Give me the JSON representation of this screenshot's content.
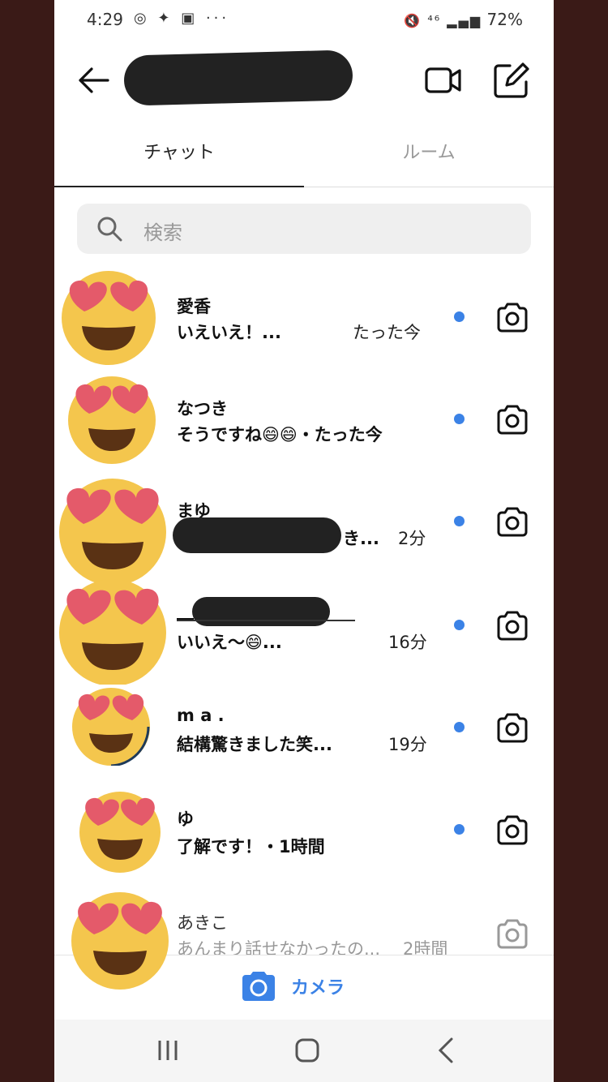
{
  "status": {
    "time": "4:29",
    "battery": "72%",
    "left_icons": "◎ ✦ ▣ ···",
    "right_icons": "🔇 ⁴⁶ ▂▄▆"
  },
  "tabs": [
    {
      "label": "チャット"
    },
    {
      "label": "ルーム"
    }
  ],
  "search": {
    "placeholder": "検索"
  },
  "chats": [
    {
      "name": "愛香",
      "message": "いえいえ！...",
      "time": "たった今"
    },
    {
      "name": "なつき",
      "message": "そうですね😄😄・たった今",
      "time": ""
    },
    {
      "name": "まゆ",
      "message": "き...",
      "time": "2分"
    },
    {
      "name": "__",
      "message": "いいえ〜😄...",
      "time": "16分"
    },
    {
      "name": "m a .",
      "message": "結構驚きました笑...",
      "time": "19分"
    },
    {
      "name": "ゆ",
      "message": "了解です！・1時間",
      "time": ""
    },
    {
      "name": "あきこ",
      "message": "あんまり話せなかったの...",
      "time": "2時間"
    }
  ],
  "camera_bar": {
    "label": "カメラ"
  },
  "icons": {
    "back": "back-arrow-icon",
    "video": "video-camera-icon",
    "edit": "compose-icon",
    "search": "search-icon",
    "row_camera": "camera-icon",
    "avatar": "heart-eyes-emoji-icon"
  },
  "colors": {
    "accent": "#3b82e6",
    "unread_dot": "#3b82e6",
    "background_frame": "#3a1a17"
  }
}
